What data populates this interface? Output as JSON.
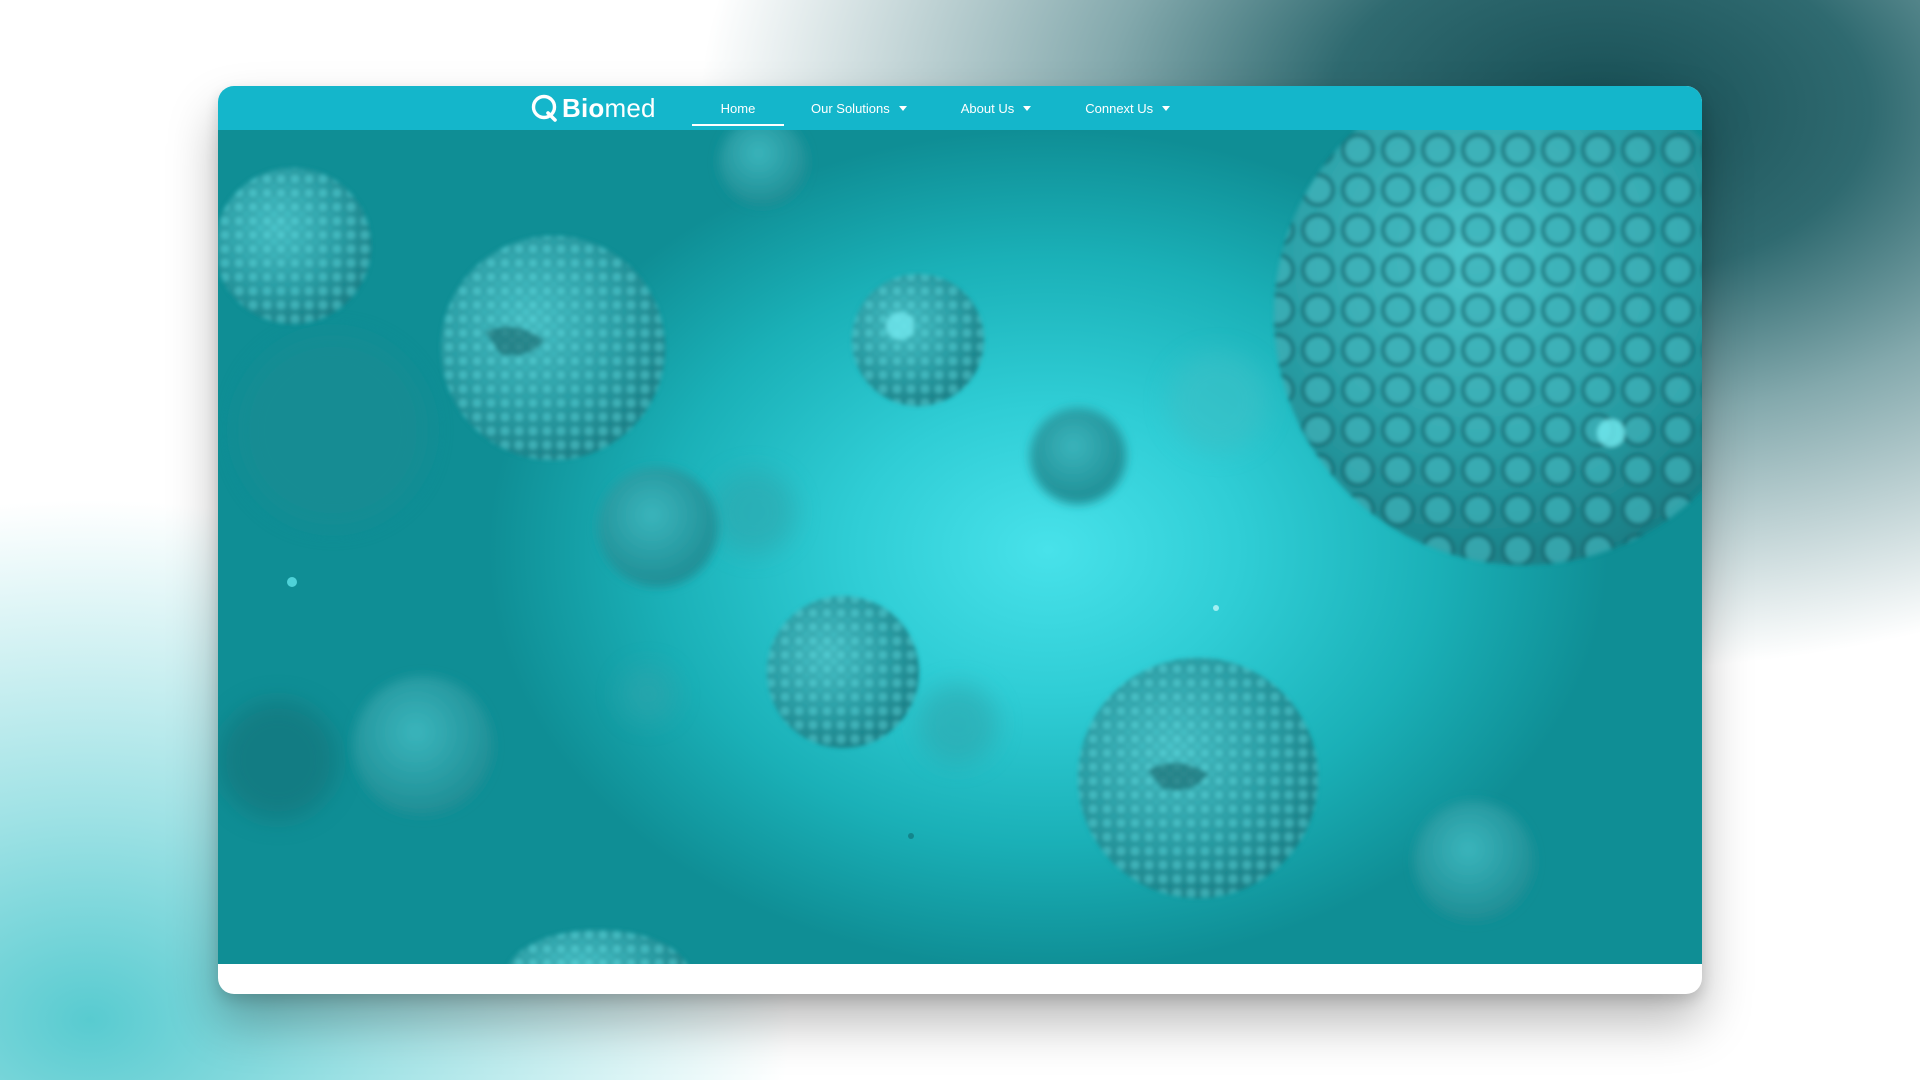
{
  "brand": {
    "name_bold": "Bio",
    "name_light": "med",
    "logo_icon": "q-ring-logo-icon"
  },
  "nav": {
    "items": [
      {
        "label": "Home",
        "active": true,
        "has_dropdown": false
      },
      {
        "label": "Our Solutions",
        "active": false,
        "has_dropdown": true
      },
      {
        "label": "About Us",
        "active": false,
        "has_dropdown": true
      },
      {
        "label": "Connext Us",
        "active": false,
        "has_dropdown": true
      }
    ],
    "dropdown_icon": "caret-down-icon"
  },
  "hero": {
    "image": "microscopic-cells-hero-image"
  },
  "colors": {
    "nav_bar": "#14b6cb",
    "hero_center": "#48e2ea",
    "hero_edge": "#0f8e95",
    "cell": "#2aa6ad",
    "cell_highlight": "#6fe6ec"
  }
}
